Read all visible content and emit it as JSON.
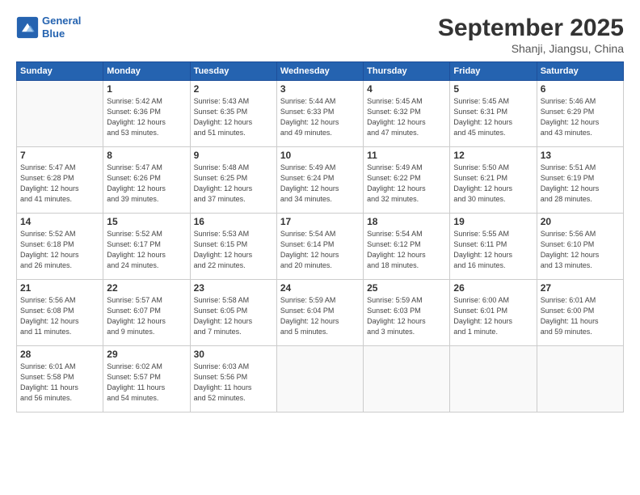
{
  "header": {
    "logo_line1": "General",
    "logo_line2": "Blue",
    "month": "September 2025",
    "location": "Shanji, Jiangsu, China"
  },
  "weekdays": [
    "Sunday",
    "Monday",
    "Tuesday",
    "Wednesday",
    "Thursday",
    "Friday",
    "Saturday"
  ],
  "weeks": [
    [
      {
        "day": "",
        "info": ""
      },
      {
        "day": "1",
        "info": "Sunrise: 5:42 AM\nSunset: 6:36 PM\nDaylight: 12 hours\nand 53 minutes."
      },
      {
        "day": "2",
        "info": "Sunrise: 5:43 AM\nSunset: 6:35 PM\nDaylight: 12 hours\nand 51 minutes."
      },
      {
        "day": "3",
        "info": "Sunrise: 5:44 AM\nSunset: 6:33 PM\nDaylight: 12 hours\nand 49 minutes."
      },
      {
        "day": "4",
        "info": "Sunrise: 5:45 AM\nSunset: 6:32 PM\nDaylight: 12 hours\nand 47 minutes."
      },
      {
        "day": "5",
        "info": "Sunrise: 5:45 AM\nSunset: 6:31 PM\nDaylight: 12 hours\nand 45 minutes."
      },
      {
        "day": "6",
        "info": "Sunrise: 5:46 AM\nSunset: 6:29 PM\nDaylight: 12 hours\nand 43 minutes."
      }
    ],
    [
      {
        "day": "7",
        "info": "Sunrise: 5:47 AM\nSunset: 6:28 PM\nDaylight: 12 hours\nand 41 minutes."
      },
      {
        "day": "8",
        "info": "Sunrise: 5:47 AM\nSunset: 6:26 PM\nDaylight: 12 hours\nand 39 minutes."
      },
      {
        "day": "9",
        "info": "Sunrise: 5:48 AM\nSunset: 6:25 PM\nDaylight: 12 hours\nand 37 minutes."
      },
      {
        "day": "10",
        "info": "Sunrise: 5:49 AM\nSunset: 6:24 PM\nDaylight: 12 hours\nand 34 minutes."
      },
      {
        "day": "11",
        "info": "Sunrise: 5:49 AM\nSunset: 6:22 PM\nDaylight: 12 hours\nand 32 minutes."
      },
      {
        "day": "12",
        "info": "Sunrise: 5:50 AM\nSunset: 6:21 PM\nDaylight: 12 hours\nand 30 minutes."
      },
      {
        "day": "13",
        "info": "Sunrise: 5:51 AM\nSunset: 6:19 PM\nDaylight: 12 hours\nand 28 minutes."
      }
    ],
    [
      {
        "day": "14",
        "info": "Sunrise: 5:52 AM\nSunset: 6:18 PM\nDaylight: 12 hours\nand 26 minutes."
      },
      {
        "day": "15",
        "info": "Sunrise: 5:52 AM\nSunset: 6:17 PM\nDaylight: 12 hours\nand 24 minutes."
      },
      {
        "day": "16",
        "info": "Sunrise: 5:53 AM\nSunset: 6:15 PM\nDaylight: 12 hours\nand 22 minutes."
      },
      {
        "day": "17",
        "info": "Sunrise: 5:54 AM\nSunset: 6:14 PM\nDaylight: 12 hours\nand 20 minutes."
      },
      {
        "day": "18",
        "info": "Sunrise: 5:54 AM\nSunset: 6:12 PM\nDaylight: 12 hours\nand 18 minutes."
      },
      {
        "day": "19",
        "info": "Sunrise: 5:55 AM\nSunset: 6:11 PM\nDaylight: 12 hours\nand 16 minutes."
      },
      {
        "day": "20",
        "info": "Sunrise: 5:56 AM\nSunset: 6:10 PM\nDaylight: 12 hours\nand 13 minutes."
      }
    ],
    [
      {
        "day": "21",
        "info": "Sunrise: 5:56 AM\nSunset: 6:08 PM\nDaylight: 12 hours\nand 11 minutes."
      },
      {
        "day": "22",
        "info": "Sunrise: 5:57 AM\nSunset: 6:07 PM\nDaylight: 12 hours\nand 9 minutes."
      },
      {
        "day": "23",
        "info": "Sunrise: 5:58 AM\nSunset: 6:05 PM\nDaylight: 12 hours\nand 7 minutes."
      },
      {
        "day": "24",
        "info": "Sunrise: 5:59 AM\nSunset: 6:04 PM\nDaylight: 12 hours\nand 5 minutes."
      },
      {
        "day": "25",
        "info": "Sunrise: 5:59 AM\nSunset: 6:03 PM\nDaylight: 12 hours\nand 3 minutes."
      },
      {
        "day": "26",
        "info": "Sunrise: 6:00 AM\nSunset: 6:01 PM\nDaylight: 12 hours\nand 1 minute."
      },
      {
        "day": "27",
        "info": "Sunrise: 6:01 AM\nSunset: 6:00 PM\nDaylight: 11 hours\nand 59 minutes."
      }
    ],
    [
      {
        "day": "28",
        "info": "Sunrise: 6:01 AM\nSunset: 5:58 PM\nDaylight: 11 hours\nand 56 minutes."
      },
      {
        "day": "29",
        "info": "Sunrise: 6:02 AM\nSunset: 5:57 PM\nDaylight: 11 hours\nand 54 minutes."
      },
      {
        "day": "30",
        "info": "Sunrise: 6:03 AM\nSunset: 5:56 PM\nDaylight: 11 hours\nand 52 minutes."
      },
      {
        "day": "",
        "info": ""
      },
      {
        "day": "",
        "info": ""
      },
      {
        "day": "",
        "info": ""
      },
      {
        "day": "",
        "info": ""
      }
    ]
  ]
}
